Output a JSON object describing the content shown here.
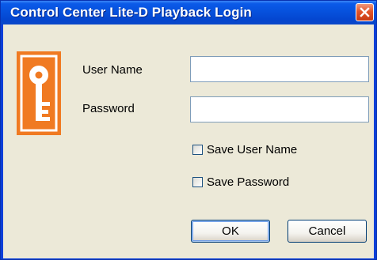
{
  "window": {
    "title": "Control Center Lite-D Playback Login"
  },
  "form": {
    "username_label": "User Name",
    "username_value": "",
    "password_label": "Password",
    "password_value": "",
    "save_username_label": "Save User Name",
    "save_username_checked": false,
    "save_password_label": "Save Password",
    "save_password_checked": false
  },
  "buttons": {
    "ok_label": "OK",
    "cancel_label": "Cancel"
  },
  "colors": {
    "titlebar": "#0651dd",
    "close_button": "#e2542a",
    "dialog_background": "#ece9d8",
    "key_icon": "#f07a22"
  },
  "icons": {
    "close": "close-icon",
    "key": "key-icon"
  }
}
